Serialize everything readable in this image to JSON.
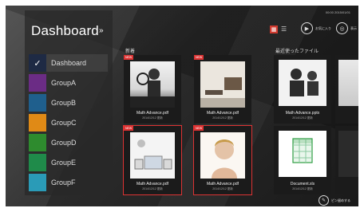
{
  "status_text": "00:00 2015/01/01",
  "sidebar": {
    "title": "Dashboard",
    "collapse_glyph": "»",
    "items": [
      {
        "label": "Dashboard",
        "color": "#1e2a44",
        "active": true
      },
      {
        "label": "GroupA",
        "color": "#6b2c85"
      },
      {
        "label": "GroupB",
        "color": "#1f5f8d"
      },
      {
        "label": "GroupC",
        "color": "#e08a16"
      },
      {
        "label": "GroupD",
        "color": "#2e8b2e"
      },
      {
        "label": "GroupE",
        "color": "#1f8b4a"
      },
      {
        "label": "GroupF",
        "color": "#2a9bb7"
      }
    ]
  },
  "toolbar": {
    "grid_view_icon": "grid-icon",
    "list_view_icon": "list-icon",
    "btn1_label": "お気に入り",
    "btn2_label": "表示"
  },
  "sections": {
    "left_title": "新着",
    "right_title": "最近使ったファイル"
  },
  "tiles": [
    {
      "badge": "NEW",
      "name": "Math Advance.pdf",
      "date": "2014/12/12 更新"
    },
    {
      "badge": "NEW",
      "name": "Math Advance.pdf",
      "date": "2014/12/12 更新"
    },
    {
      "badge": "NEW",
      "name": "Math Advance.pdf",
      "date": "2014/12/12 更新"
    },
    {
      "badge": "NEW",
      "name": "Math Advance.pdf",
      "date": "2014/12/12 更新"
    }
  ],
  "recent": [
    {
      "name": "Math Advance.pptx",
      "date": "2014/12/12 更新"
    },
    {
      "name": "",
      "date": ""
    },
    {
      "name": "Document.xls",
      "date": "2014/12/12 更新"
    },
    {
      "name": "",
      "date": ""
    }
  ],
  "bottom_action": {
    "label": "ピン留めする",
    "icon": "pin-icon"
  }
}
